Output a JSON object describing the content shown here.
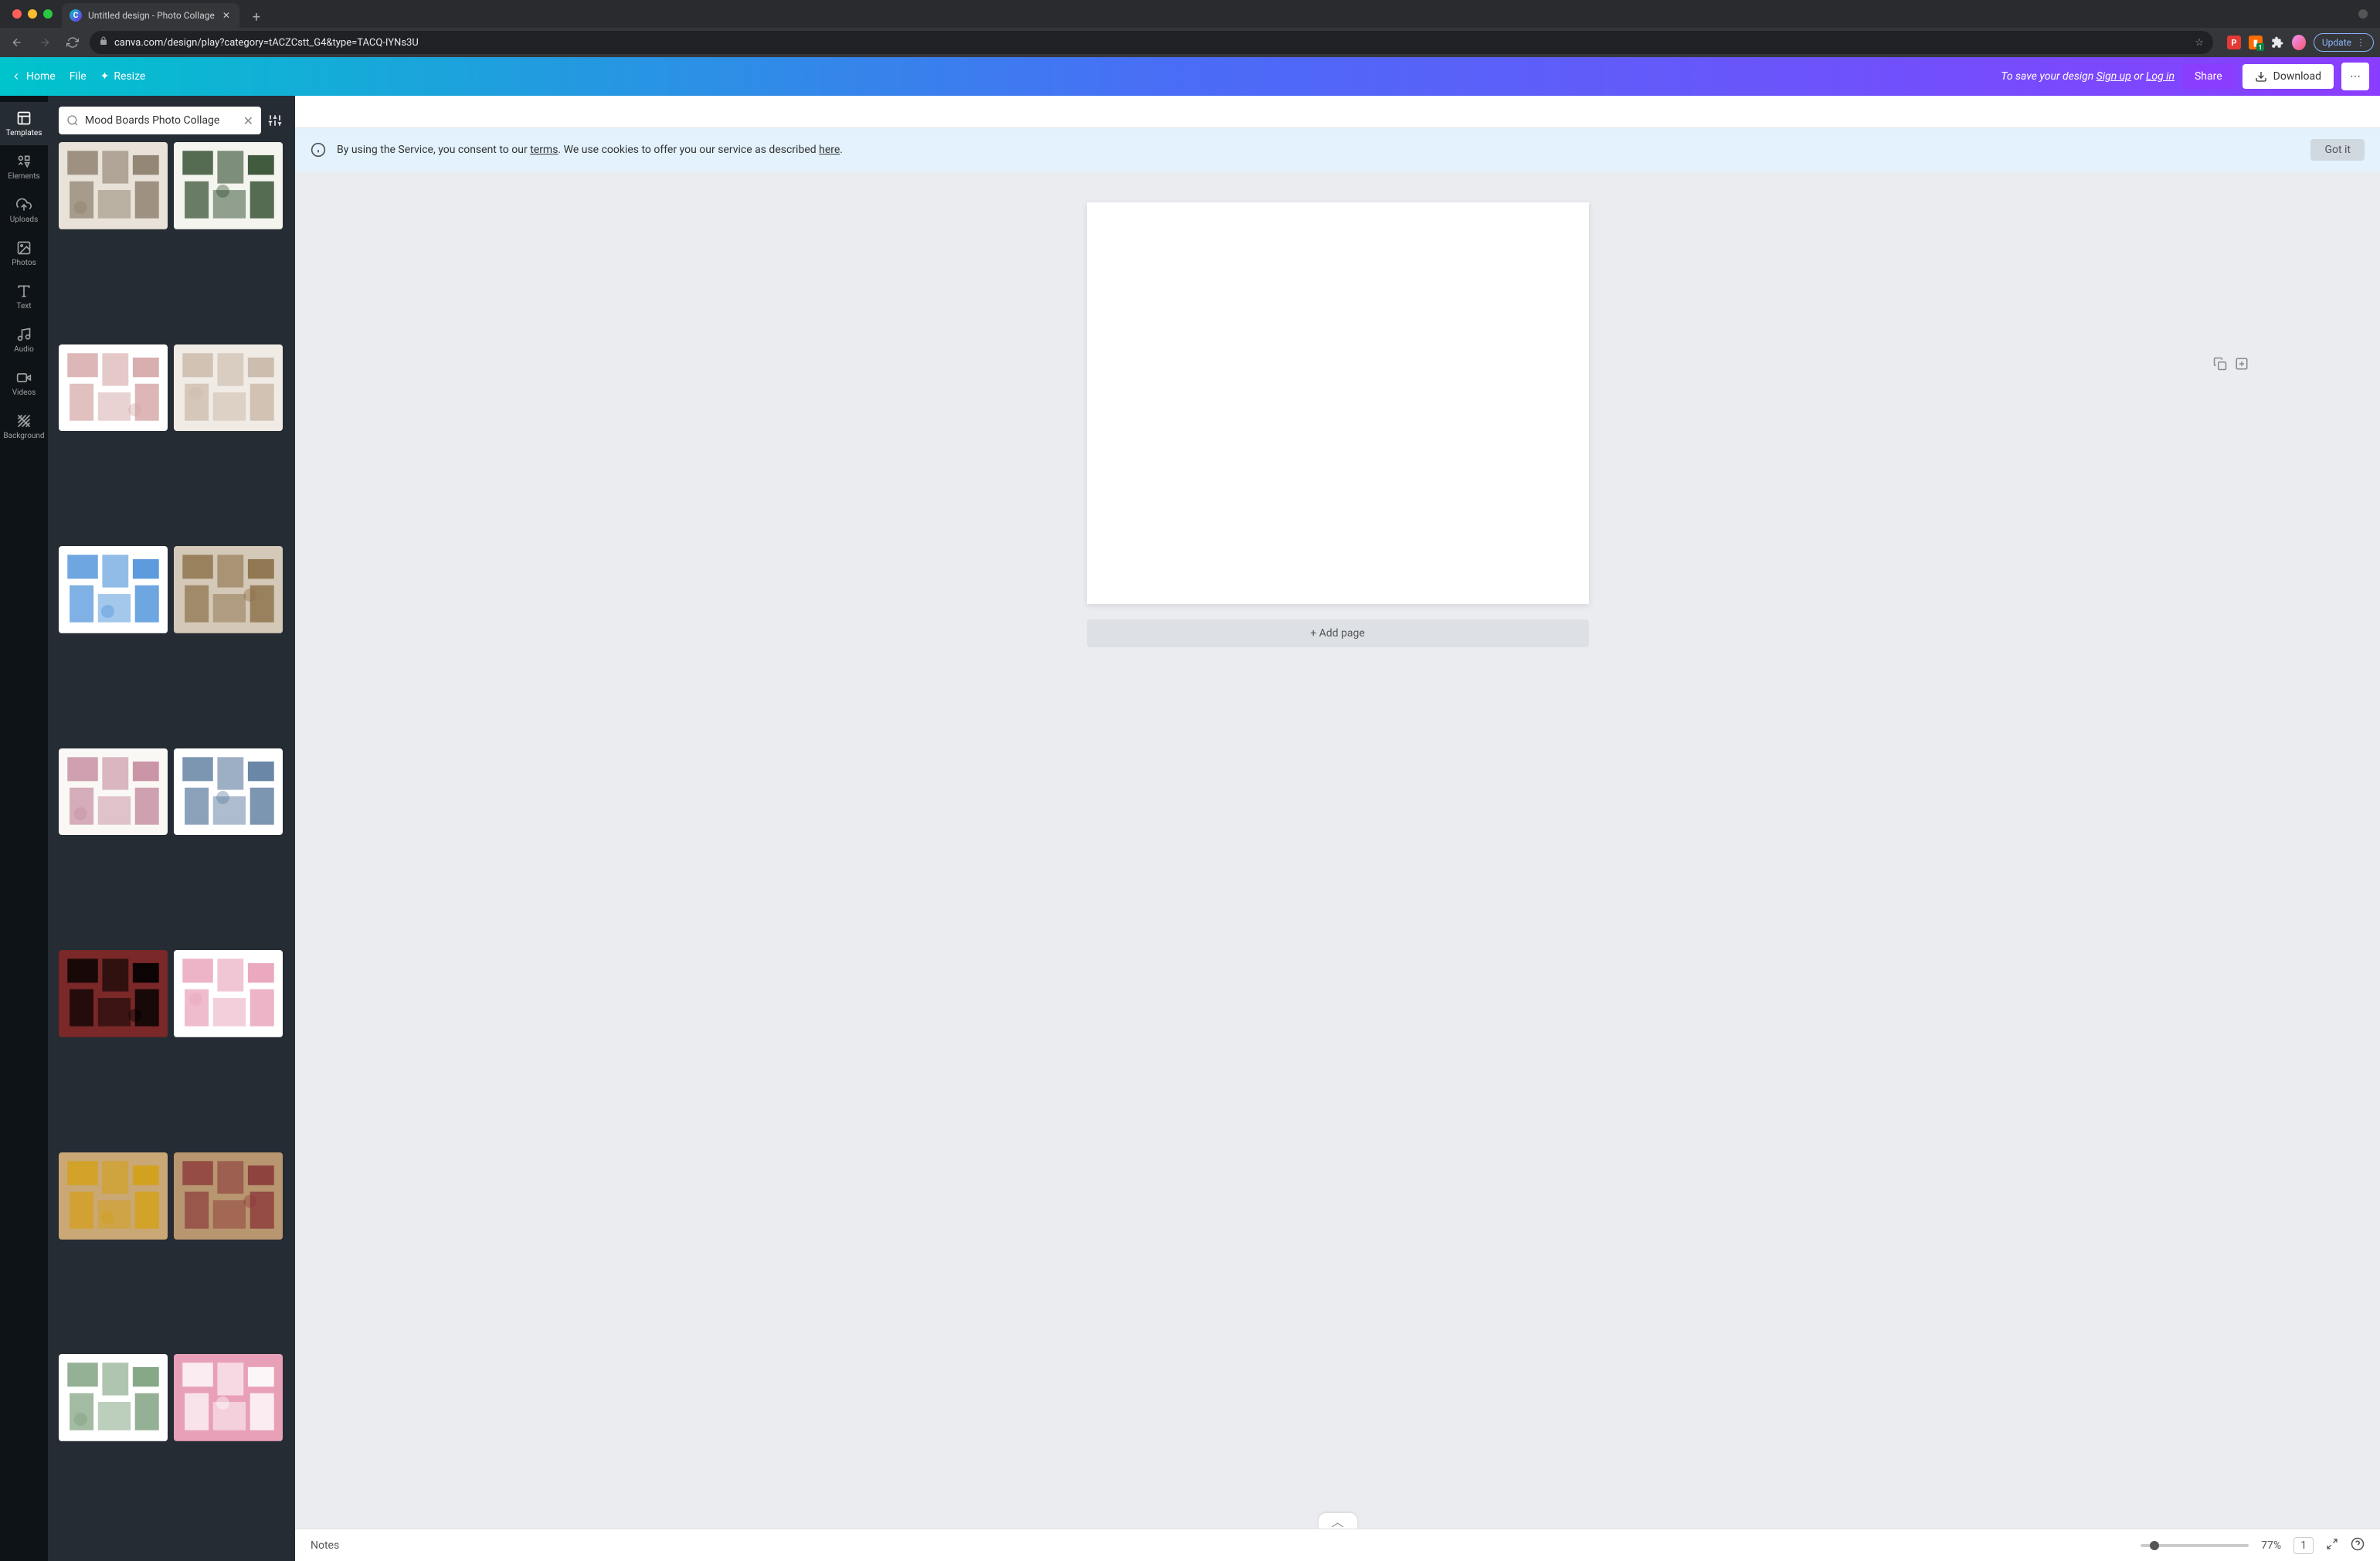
{
  "browser": {
    "tab_title": "Untitled design - Photo Collage",
    "url": "canva.com/design/play?category=tACZCstt_G4&type=TACQ-IYNs3U",
    "update_label": "Update"
  },
  "header": {
    "home": "Home",
    "file": "File",
    "resize": "Resize",
    "save_prefix": "To save your design ",
    "signup": "Sign up",
    "or": " or ",
    "login": "Log in",
    "share": "Share",
    "download": "Download"
  },
  "nav": {
    "templates": "Templates",
    "elements": "Elements",
    "uploads": "Uploads",
    "photos": "Photos",
    "text": "Text",
    "audio": "Audio",
    "videos": "Videos",
    "background": "Background"
  },
  "search": {
    "value": "Mood Boards Photo Collage"
  },
  "cookie": {
    "text_prefix": "By using the Service, you consent to our ",
    "terms": "terms",
    "text_mid": ". We use cookies to offer you our service as described ",
    "here": "here",
    "text_suffix": ".",
    "got_it": "Got it"
  },
  "canvas": {
    "add_page": "+ Add page"
  },
  "footer": {
    "notes": "Notes",
    "zoom": "77%",
    "page_count": "1"
  },
  "templates": [
    {
      "bg": "#e8e2d8",
      "accent": "#8b7d6b"
    },
    {
      "bg": "#f5f5f0",
      "accent": "#2d4a2b"
    },
    {
      "bg": "#ffffff",
      "accent": "#d4a5a5"
    },
    {
      "bg": "#f0ebe5",
      "accent": "#c9b8a8"
    },
    {
      "bg": "#ffffff",
      "accent": "#4a90d9"
    },
    {
      "bg": "#d4c9b8",
      "accent": "#8b6f47"
    },
    {
      "bg": "#faf8f5",
      "accent": "#c48b9f"
    },
    {
      "bg": "#ffffff",
      "accent": "#5b7a9e"
    },
    {
      "bg": "#7a2828",
      "accent": "#000000"
    },
    {
      "bg": "#ffffff",
      "accent": "#e8a0b8"
    },
    {
      "bg": "#c9a876",
      "accent": "#d4a017"
    },
    {
      "bg": "#b8966f",
      "accent": "#8b3a3a"
    },
    {
      "bg": "#ffffff",
      "accent": "#7a9e7a"
    },
    {
      "bg": "#e8a0b8",
      "accent": "#ffffff"
    }
  ]
}
